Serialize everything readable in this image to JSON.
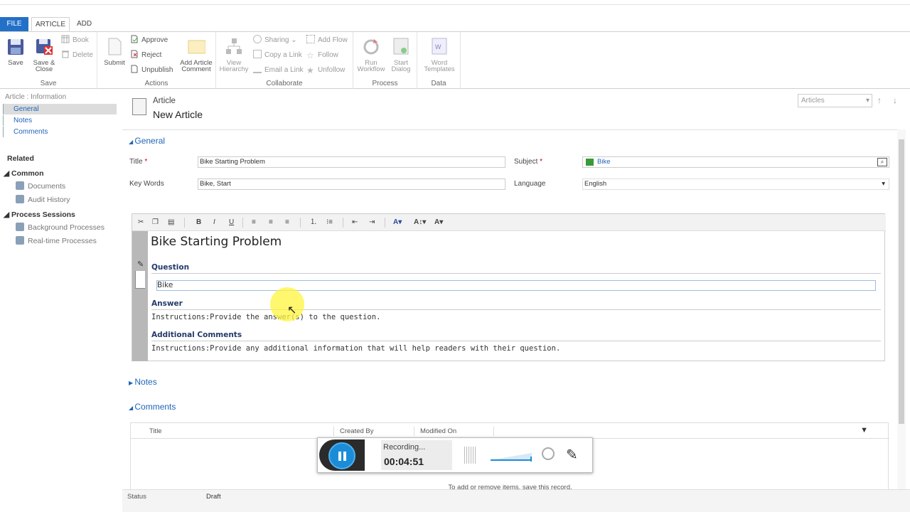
{
  "tabs": {
    "file": "FILE",
    "article": "ARTICLE",
    "add": "ADD"
  },
  "ribbon": {
    "save": {
      "save": "Save",
      "save_close": "Save & Close",
      "book": "Book",
      "delete": "Delete",
      "label": "Save"
    },
    "actions": {
      "submit": "Submit",
      "approve": "Approve",
      "reject": "Reject",
      "unpublish": "Unpublish",
      "add_comment": "Add Article Comment",
      "label": "Actions"
    },
    "collaborate": {
      "view_hierarchy": "View Hierarchy",
      "sharing": "Sharing",
      "copy_link": "Copy a Link",
      "email_link": "Email a Link",
      "add_flow": "Add Flow",
      "follow": "Follow",
      "unfollow": "Unfollow",
      "label": "Collaborate"
    },
    "process": {
      "run_workflow": "Run Workflow",
      "start_dialog": "Start Dialog",
      "label": "Process"
    },
    "data": {
      "word_templates": "Word Templates",
      "label": "Data"
    }
  },
  "leftnav": {
    "breadcrumb": "Article : Information",
    "items": [
      "General",
      "Notes",
      "Comments"
    ],
    "related": "Related",
    "common": "Common",
    "common_items": [
      "Documents",
      "Audit History"
    ],
    "process_sessions": "Process Sessions",
    "process_items": [
      "Background Processes",
      "Real-time Processes"
    ]
  },
  "header": {
    "entity": "Article",
    "title": "New Article",
    "view_selector": "Articles"
  },
  "general": {
    "section": "General",
    "title_label": "Title",
    "title_value": "Bike Starting Problem",
    "subject_label": "Subject",
    "subject_value": "Bike",
    "keywords_label": "Key Words",
    "keywords_value": "Bike, Start",
    "language_label": "Language",
    "language_value": "English"
  },
  "editor": {
    "toolbar": {
      "bold": "B",
      "italic": "I",
      "underline": "U"
    },
    "heading": "Bike Starting Problem",
    "question_label": "Question",
    "question_value": "Bike",
    "answer_label": "Answer",
    "answer_text": "Instructions:Provide the answer(s) to the question.",
    "comments_label": "Additional Comments",
    "comments_text": "Instructions:Provide any additional information that will help readers with their question."
  },
  "notes_section": "Notes",
  "comments_section": {
    "label": "Comments",
    "columns": [
      "Title",
      "Created By",
      "Modified On"
    ],
    "empty_note": "To add or remove items, save this record."
  },
  "footer": {
    "status_label": "Status",
    "status_value": "Draft"
  },
  "recorder": {
    "status": "Recording...",
    "time": "00:04:51"
  },
  "colors": {
    "accent": "#2370c8",
    "link": "#2266b8",
    "record_button": "#1b8dd8"
  }
}
